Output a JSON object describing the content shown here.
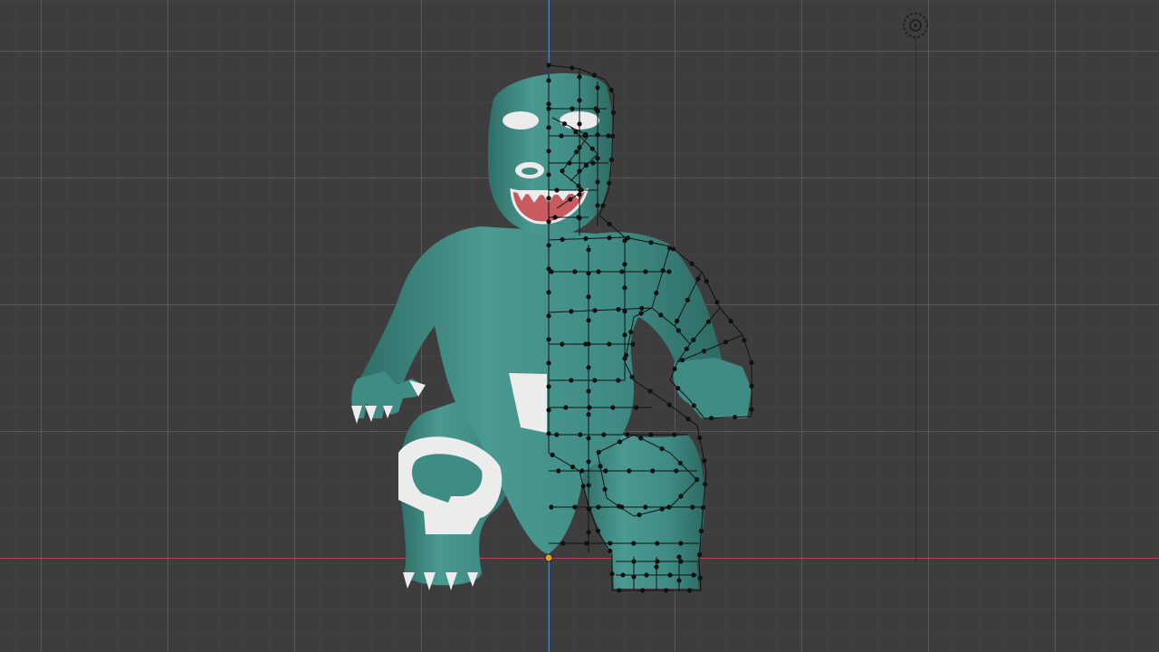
{
  "viewport": {
    "background": "#3d3d3d",
    "x_axis_color": "#b0474f",
    "y_axis_color": "#4b7bc4",
    "model_color": "#3f8c84",
    "model_shadow": "#2d6a63",
    "accent_white": "#f2f2f2",
    "mouth_color": "#c85a60",
    "wire_color": "#111111",
    "icons": [
      "view-target-icon",
      "origin-point-icon"
    ]
  }
}
